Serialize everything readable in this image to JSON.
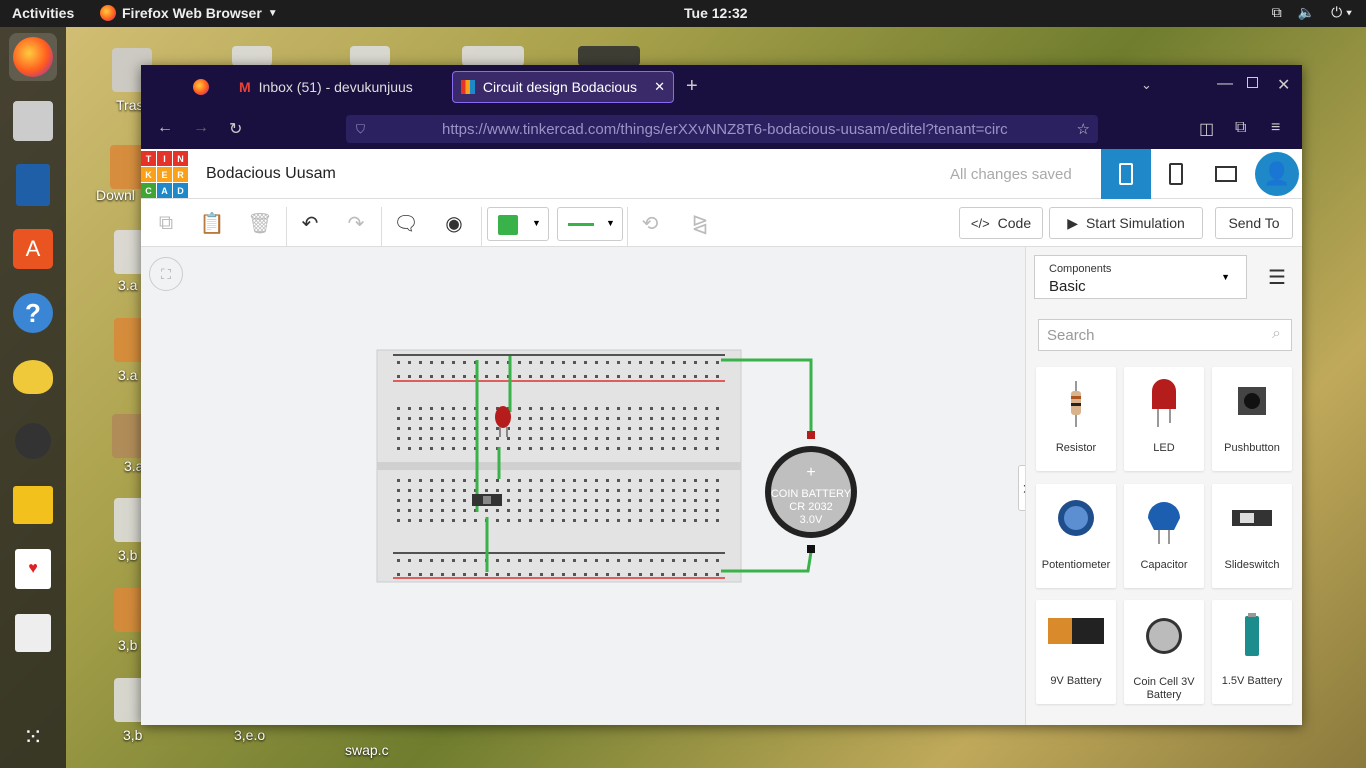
{
  "topbar": {
    "activities": "Activities",
    "app_name": "Firefox Web Browser",
    "clock": "Tue 12:32"
  },
  "desktop": {
    "icons": [
      "Tras",
      "Downl",
      "3.a",
      "3.a",
      "3.a",
      "3,b",
      "3,b",
      "3,b",
      "3,e.o",
      "swap.c"
    ]
  },
  "browser": {
    "tabs": [
      {
        "label": "Inbox (51) - devukunjuus"
      },
      {
        "label": "Circuit design Bodacious"
      }
    ],
    "url": "https://www.tinkercad.com/things/erXXvNNZ8T6-bodacious-uusam/editel?tenant=circ"
  },
  "app": {
    "logo_letters": [
      "T",
      "I",
      "N",
      "K",
      "E",
      "R",
      "C",
      "A",
      "D"
    ],
    "logo_colors": [
      "#e6332a",
      "#e6332a",
      "#e6332a",
      "#f9a11b",
      "#f9a11b",
      "#f9a11b",
      "#3fa535",
      "#1e88c9",
      "#1e88c9"
    ],
    "project_title": "Bodacious Uusam",
    "save_status": "All changes saved",
    "accent": "#1e88c9"
  },
  "toolbar": {
    "code_label": "Code",
    "start_label": "Start Simulation",
    "send_label": "Send To",
    "color_swatch": "#3ab24a"
  },
  "components": {
    "dropdown_label": "Components",
    "dropdown_value": "Basic",
    "search_placeholder": "Search",
    "items": [
      "Resistor",
      "LED",
      "Pushbutton",
      "Potentiometer",
      "Capacitor",
      "Slideswitch",
      "9V Battery",
      "Coin Cell 3V Battery",
      "1.5V Battery"
    ]
  },
  "circuit": {
    "battery_label_1": "COIN BATTERY",
    "battery_label_2": "CR 2032",
    "battery_label_3": "3.0V",
    "battery_plus": "+",
    "wire_color": "#3ab24a"
  }
}
